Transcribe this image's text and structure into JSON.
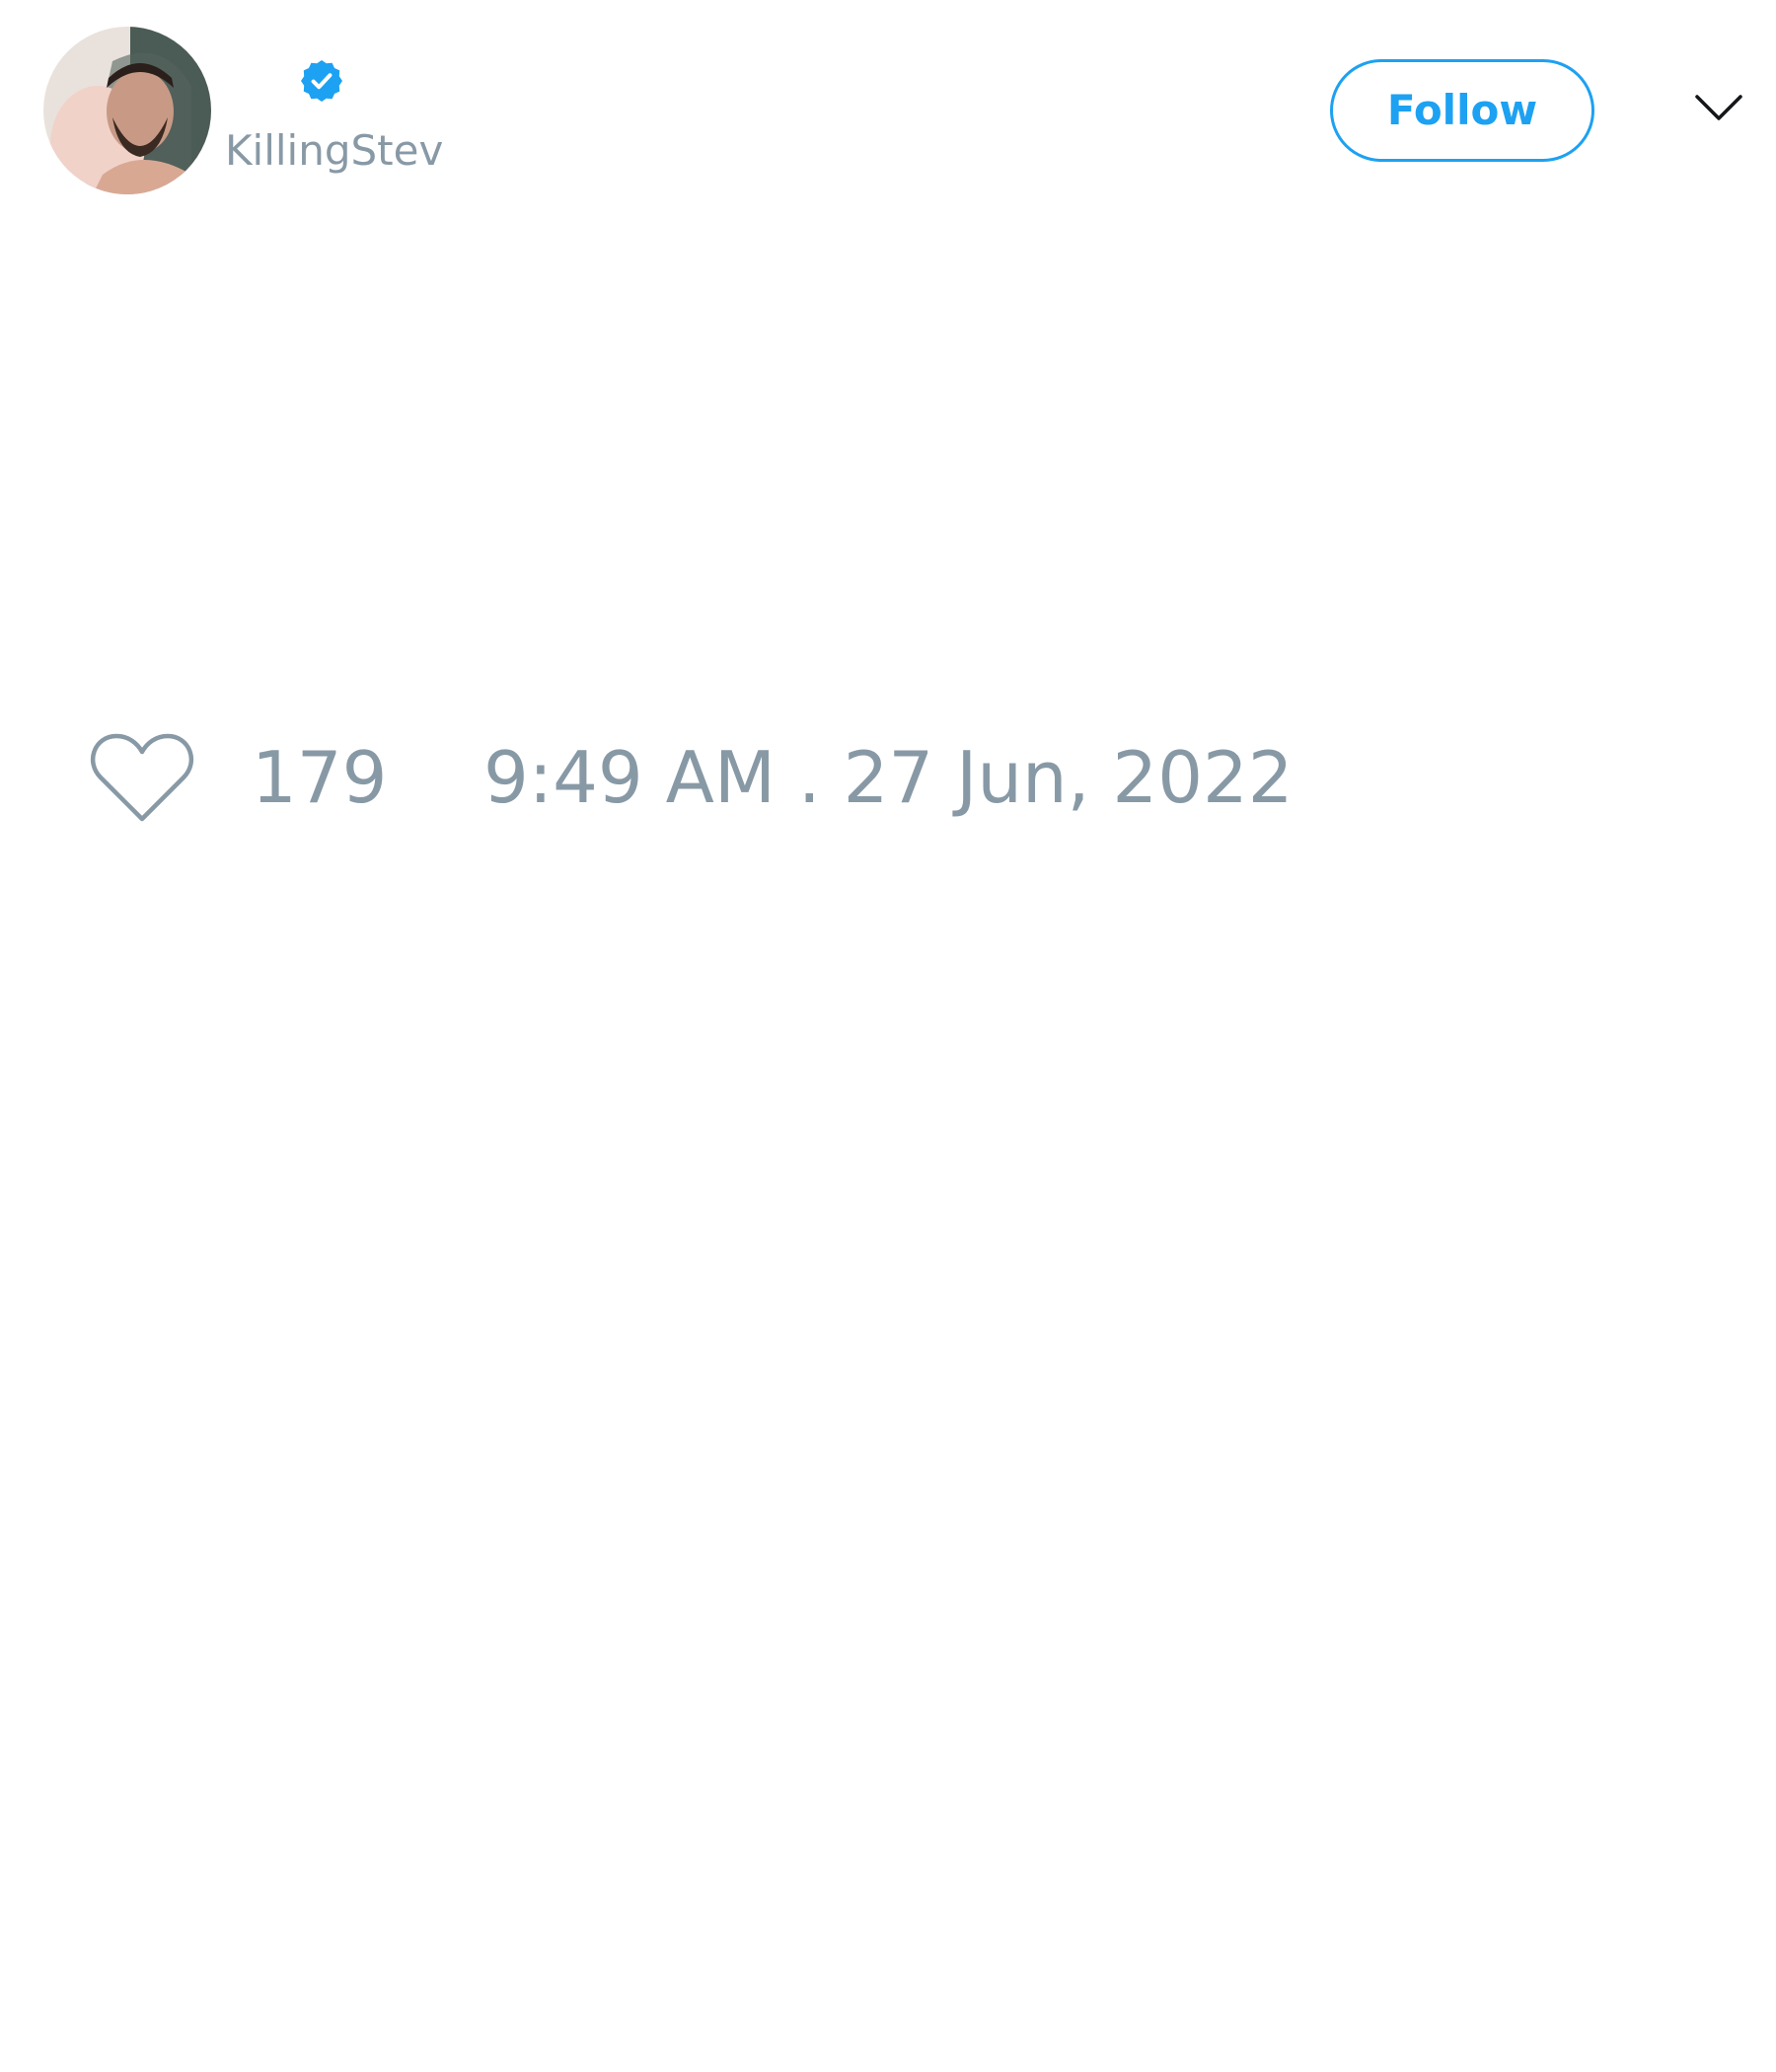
{
  "tweet": {
    "author": {
      "handle": "KillingStev",
      "verified": true,
      "avatar_icon": "profile-photo"
    },
    "follow_button": {
      "label": "Follow"
    },
    "menu_icon": "chevron-down-icon",
    "like_icon": "heart-outline-icon",
    "like_count": "179",
    "timestamp": "9:49 AM . 27 Jun, 2022"
  },
  "colors": {
    "accent": "#1da1f2",
    "muted_text": "#8899a6",
    "background": "#ffffff"
  }
}
